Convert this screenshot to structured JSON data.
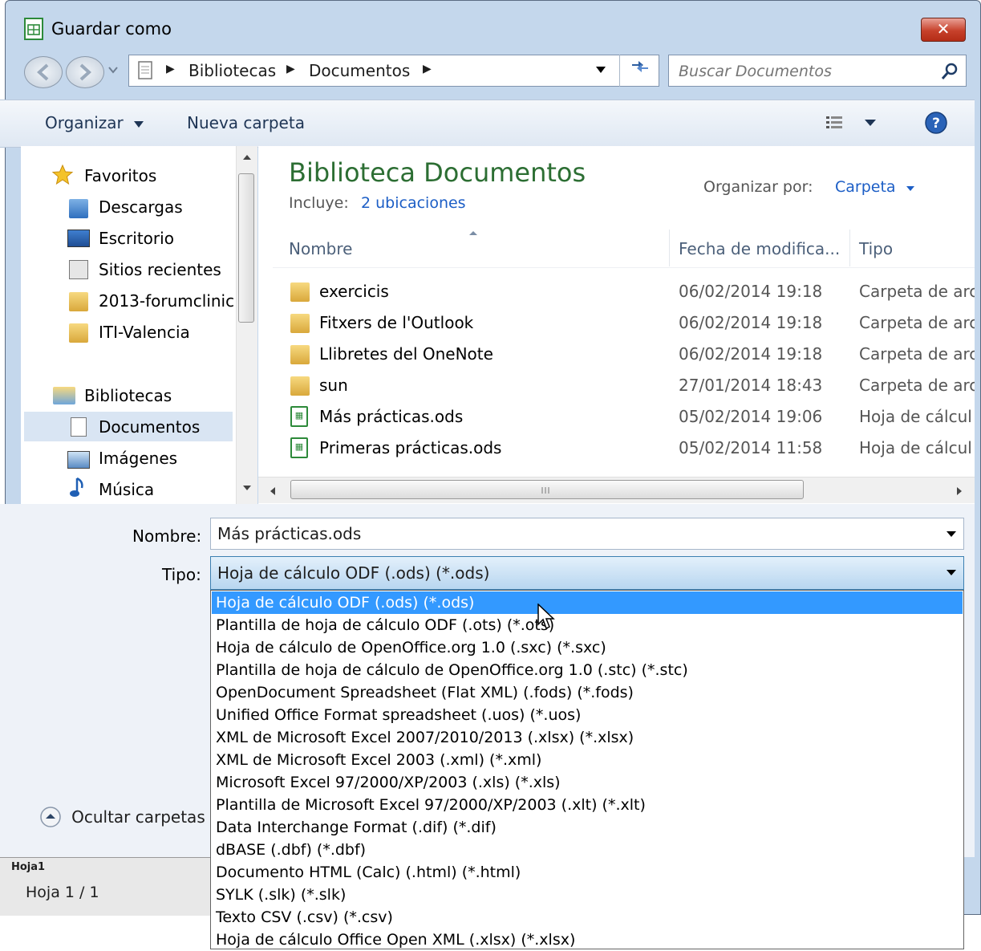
{
  "window": {
    "title": "Guardar como",
    "close_label": "✕"
  },
  "address": {
    "crumbs": [
      "Bibliotecas",
      "Documentos"
    ],
    "search_placeholder": "Buscar Documentos"
  },
  "toolbar": {
    "organize": "Organizar",
    "new_folder": "Nueva carpeta"
  },
  "nav": {
    "favorites": "Favoritos",
    "fav_items": [
      "Descargas",
      "Escritorio",
      "Sitios recientes",
      "2013-forumclinic",
      "ITI-Valencia"
    ],
    "libraries": "Bibliotecas",
    "lib_items": [
      "Documentos",
      "Imágenes",
      "Música"
    ],
    "hide_folders": "Ocultar carpetas"
  },
  "library": {
    "title": "Biblioteca Documentos",
    "includes_label": "Incluye:",
    "includes_link": "2 ubicaciones",
    "arrange_label": "Organizar por:",
    "arrange_value": "Carpeta"
  },
  "columns": {
    "name": "Nombre",
    "date": "Fecha de modifica...",
    "type": "Tipo"
  },
  "files": [
    {
      "name": "exercicis",
      "date": "06/02/2014 19:18",
      "type": "Carpeta de arc",
      "kind": "folder"
    },
    {
      "name": "Fitxers de l'Outlook",
      "date": "06/02/2014 19:18",
      "type": "Carpeta de arc",
      "kind": "folder"
    },
    {
      "name": "Llibretes del OneNote",
      "date": "06/02/2014 19:18",
      "type": "Carpeta de arc",
      "kind": "folder"
    },
    {
      "name": "sun",
      "date": "27/01/2014 18:43",
      "type": "Carpeta de arc",
      "kind": "folder"
    },
    {
      "name": "Más prácticas.ods",
      "date": "05/02/2014 19:06",
      "type": "Hoja de cálcul",
      "kind": "ods"
    },
    {
      "name": "Primeras prácticas.ods",
      "date": "05/02/2014 11:58",
      "type": "Hoja de cálcul",
      "kind": "ods"
    }
  ],
  "form": {
    "name_label": "Nombre:",
    "name_value": "Más prácticas.ods",
    "type_label": "Tipo:",
    "type_value": "Hoja de cálculo ODF (.ods) (*.ods)"
  },
  "type_options": [
    "Hoja de cálculo ODF (.ods) (*.ods)",
    "Plantilla de hoja de cálculo ODF (.ots) (*.ots)",
    "Hoja de cálculo de OpenOffice.org 1.0 (.sxc) (*.sxc)",
    "Plantilla de hoja de cálculo de OpenOffice.org 1.0 (.stc) (*.stc)",
    "OpenDocument Spreadsheet (Flat XML) (.fods) (*.fods)",
    "Unified Office Format spreadsheet (.uos) (*.uos)",
    "XML de Microsoft Excel 2007/2010/2013 (.xlsx) (*.xlsx)",
    "XML de Microsoft Excel 2003 (.xml) (*.xml)",
    "Microsoft Excel 97/2000/XP/2003 (.xls) (*.xls)",
    "Plantilla de Microsoft Excel 97/2000/XP/2003 (.xlt) (*.xlt)",
    "Data Interchange Format (.dif) (*.dif)",
    "dBASE (.dbf) (*.dbf)",
    "Documento HTML (Calc) (.html) (*.html)",
    "SYLK (.slk) (*.slk)",
    "Texto CSV (.csv) (*.csv)",
    "Hoja de cálculo Office Open XML (.xlsx) (*.xlsx)"
  ],
  "background_app": {
    "sheet_tab": "Hoja1",
    "status": "Hoja 1 / 1"
  },
  "colors": {
    "accent": "#3399ff",
    "library_title": "#2c6e33",
    "link": "#1c5ec6"
  }
}
